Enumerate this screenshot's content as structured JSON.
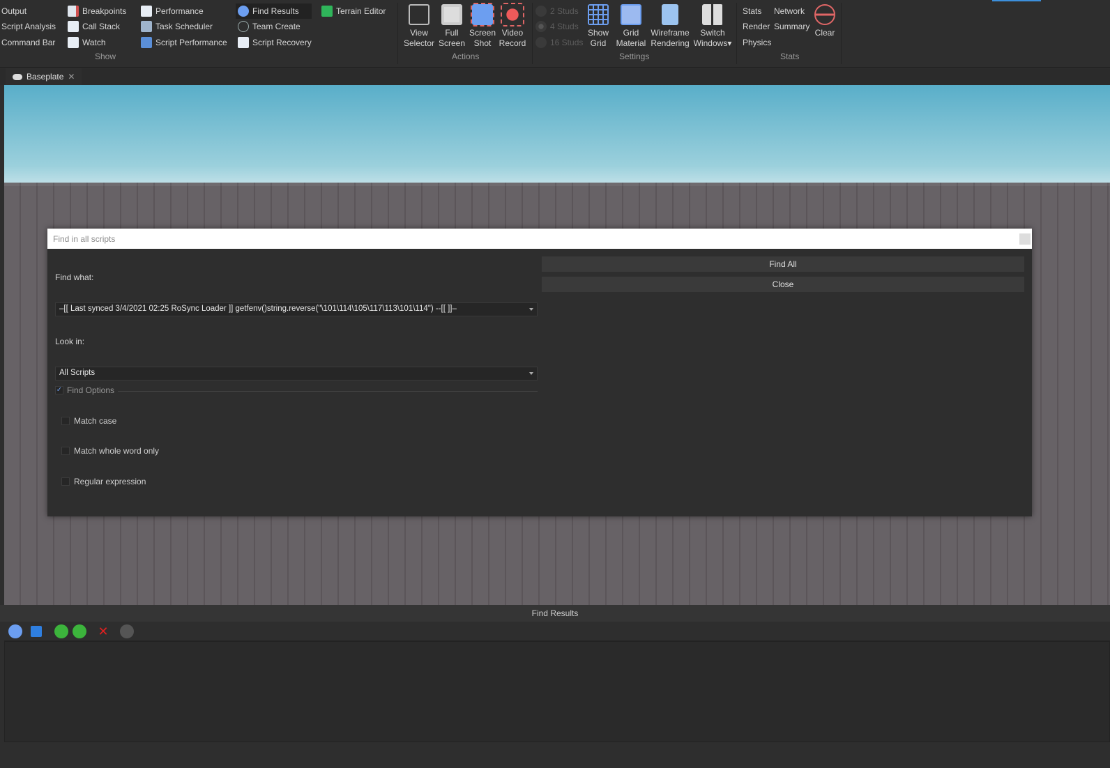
{
  "ribbon": {
    "show": {
      "label": "Show",
      "col1": [
        "Output",
        "Script Analysis",
        "Command Bar"
      ],
      "col2": [
        "Breakpoints",
        "Call Stack",
        "Watch"
      ],
      "col3": [
        "Performance",
        "Task Scheduler",
        "Script Performance"
      ],
      "col4": [
        "Find Results",
        "Team Create",
        "Script Recovery"
      ],
      "col5": [
        "Terrain Editor"
      ]
    },
    "actions": {
      "label": "Actions",
      "items": [
        "View Selector",
        "Full Screen",
        "Screen Shot",
        "Video Record"
      ]
    },
    "settings": {
      "label": "Settings",
      "studs": [
        "2 Studs",
        "4 Studs",
        "16 Studs"
      ],
      "items": [
        "Show Grid",
        "Grid Material",
        "Wireframe Rendering",
        "Switch Windows"
      ]
    },
    "stats": {
      "label": "Stats",
      "col1": [
        "Stats",
        "Render",
        "Physics"
      ],
      "col2": [
        "Network",
        "Summary"
      ],
      "clear": "Clear"
    }
  },
  "tab": {
    "label": "Baseplate"
  },
  "dialog": {
    "title": "Find in all scripts",
    "find_what_label": "Find what:",
    "find_what_value": "–[[ Last synced 3/4/2021 02:25 RoSync Loader ]] getfenv()string.reverse(\"\\101\\114\\105\\117\\113\\101\\114\") --[[ ]]–",
    "look_in_label": "Look in:",
    "look_in_value": "All Scripts",
    "find_all": "Find All",
    "close": "Close",
    "find_options": "Find Options",
    "options": [
      "Match case",
      "Match whole word only",
      "Regular expression"
    ]
  },
  "find_results": {
    "title": "Find Results"
  },
  "colors": {
    "accent": "#3c8fdc",
    "clear": "#e06666"
  }
}
